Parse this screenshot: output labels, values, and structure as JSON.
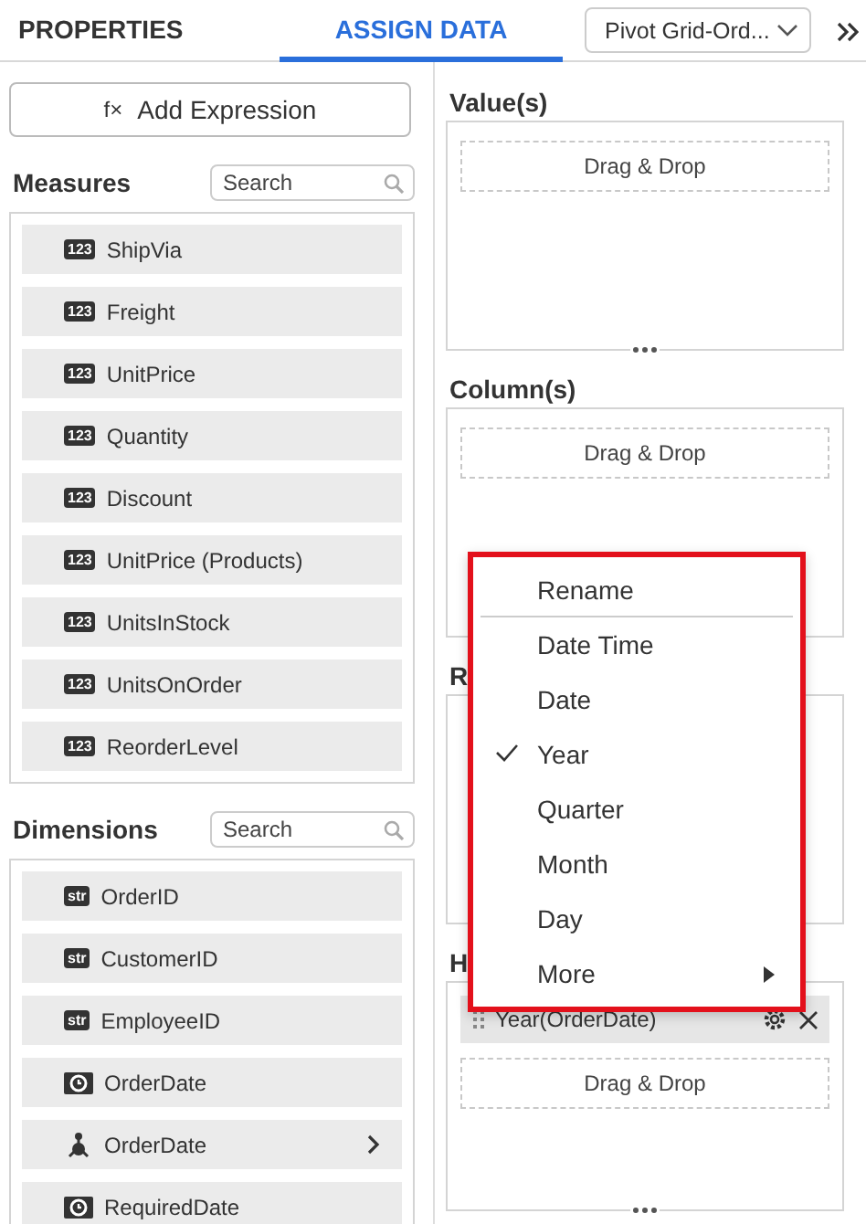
{
  "tabs": [
    {
      "label": "PROPERTIES",
      "selected": false
    },
    {
      "label": "ASSIGN DATA",
      "selected": true
    }
  ],
  "widget_select": {
    "value": "Pivot Grid-Ord..."
  },
  "left_panel": {
    "add_expression": {
      "icon_text": "f×",
      "label": "Add Expression"
    },
    "groups": [
      {
        "title": "Measures",
        "search": {
          "placeholder": "Search"
        },
        "items": [
          {
            "kind": "badge",
            "badge": "123",
            "label": "ShipVia"
          },
          {
            "kind": "badge",
            "badge": "123",
            "label": "Freight"
          },
          {
            "kind": "badge",
            "badge": "123",
            "label": "UnitPrice"
          },
          {
            "kind": "badge",
            "badge": "123",
            "label": "Quantity"
          },
          {
            "kind": "badge",
            "badge": "123",
            "label": "Discount"
          },
          {
            "kind": "badge",
            "badge": "123",
            "label": "UnitPrice (Products)"
          },
          {
            "kind": "badge",
            "badge": "123",
            "label": "UnitsInStock"
          },
          {
            "kind": "badge",
            "badge": "123",
            "label": "UnitsOnOrder"
          },
          {
            "kind": "badge",
            "badge": "123",
            "label": "ReorderLevel"
          }
        ]
      },
      {
        "title": "Dimensions",
        "search": {
          "placeholder": "Search"
        },
        "items": [
          {
            "kind": "badge",
            "badge": "str",
            "label": "OrderID"
          },
          {
            "kind": "badge",
            "badge": "str",
            "label": "CustomerID"
          },
          {
            "kind": "badge",
            "badge": "str",
            "label": "EmployeeID"
          },
          {
            "kind": "date",
            "label": "OrderDate"
          },
          {
            "kind": "hierarchy",
            "label": "OrderDate"
          },
          {
            "kind": "date",
            "label": "RequiredDate"
          }
        ]
      }
    ]
  },
  "right_panel": {
    "sections": [
      {
        "heading": "Value(s)",
        "drop_zone": "Drag & Drop"
      },
      {
        "heading": "Column(s)",
        "drop_zone": "Drag & Drop"
      },
      {
        "heading": "R"
      },
      {
        "heading": "H",
        "fields": [
          {
            "label": "Year(OrderDate)"
          }
        ],
        "drop_zone": "Drag & Drop"
      }
    ]
  },
  "context_menu": {
    "items": [
      {
        "label": "Rename",
        "checked": false,
        "submenu": false,
        "divider_after": true
      },
      {
        "label": "Date Time",
        "checked": false,
        "submenu": false,
        "divider_after": false
      },
      {
        "label": "Date",
        "checked": false,
        "submenu": false,
        "divider_after": false
      },
      {
        "label": "Year",
        "checked": true,
        "submenu": false,
        "divider_after": false
      },
      {
        "label": "Quarter",
        "checked": false,
        "submenu": false,
        "divider_after": false
      },
      {
        "label": "Month",
        "checked": false,
        "submenu": false,
        "divider_after": false
      },
      {
        "label": "Day",
        "checked": false,
        "submenu": false,
        "divider_after": false
      },
      {
        "label": "More",
        "checked": false,
        "submenu": true,
        "divider_after": false
      }
    ]
  }
}
